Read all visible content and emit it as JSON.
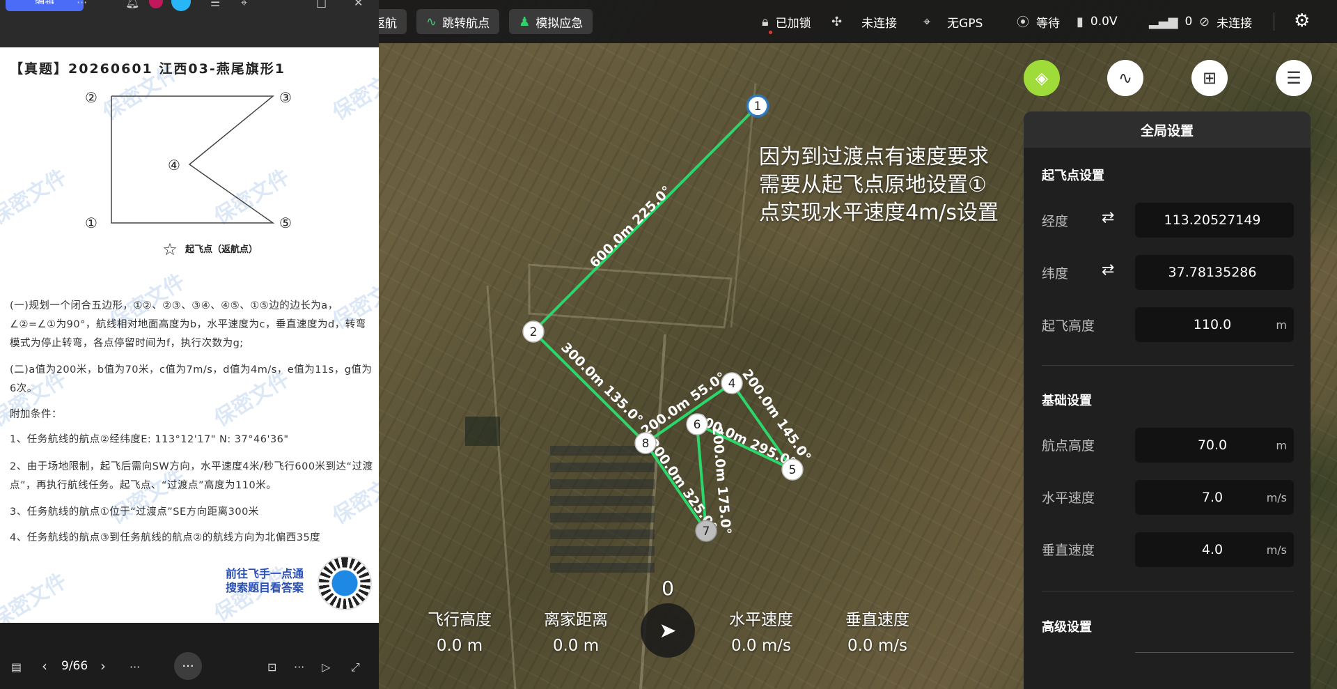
{
  "doc_viewer": {
    "edit_label": "编辑",
    "title": "【真题】20260601 江西03-燕尾旗形1",
    "diagram_labels": {
      "p1": "①",
      "p2": "②",
      "p3": "③",
      "p4": "④",
      "p5": "⑤",
      "takeoff": "起飞点（返航点）"
    },
    "paragraphs": [
      "(一)规划一个闭合五边形，①②、②③、③④、④⑤、①⑤边的边长为a，∠②=∠①为90°，航线相对地面高度为b，水平速度为c，垂直速度为d，转弯模式为停止转弯，各点停留时间为f，执行次数为g;",
      "(二)a值为200米，b值为70米，c值为7m/s，d值为4m/s，e值为11s，g值为6次。",
      "附加条件：",
      "1、任务航线的航点②经纬度E: 113°12'17\" N: 37°46'36\"",
      "2、由于场地限制，起飞后需向SW方向，水平速度4米/秒飞行600米到达“过渡点”，再执行航线任务。起飞点、“过渡点”高度为110米。",
      "3、任务航线的航点①位于“过渡点”SE方向距离300米",
      "4、任务航线的航点③到任务航线的航点②的航线方向为北偏西35度"
    ],
    "watermark": "保密文件",
    "qr_text": [
      "前往飞手一点通",
      "搜索题目看答案"
    ],
    "page_indicator": "9/66"
  },
  "toolbar": {
    "btn_return": "一键返航",
    "btn_jump": "跳转航点",
    "btn_emergency": "模拟应急",
    "lock_status": "已加锁",
    "drone_status": "未连接",
    "gps_status": "无GPS",
    "signal_status": "等待",
    "voltage": "0.0V",
    "signal_count": "0",
    "link_status": "未连接"
  },
  "map": {
    "annotation": [
      "因为到过渡点有速度要求",
      "需要从起飞点原地设置①",
      "点实现水平速度4m/s设置"
    ],
    "waypoints": [
      "1",
      "2",
      "4",
      "5",
      "6",
      "7",
      "8"
    ],
    "segment_labels": {
      "s12": "600.0m 225.0°",
      "s28": "300.0m 135.0°",
      "s84": "200.0m 55.0°",
      "s45": "200.0m 145.0°",
      "s65": "200.0m 295.0°",
      "s67": "200.0m 175.0°",
      "s87": "200.0m 325.0°"
    }
  },
  "panel": {
    "title": "全局设置",
    "takeoff_section": "起飞点设置",
    "lon_label": "经度",
    "lon_value": "113.20527149",
    "lat_label": "纬度",
    "lat_value": "37.78135286",
    "takeoff_alt_label": "起飞高度",
    "takeoff_alt_value": "110.0",
    "basic_section": "基础设置",
    "wp_alt_label": "航点高度",
    "wp_alt_value": "70.0",
    "h_speed_label": "水平速度",
    "h_speed_value": "7.0",
    "v_speed_label": "垂直速度",
    "v_speed_value": "4.0",
    "advanced_section": "高级设置",
    "unit_m": "m",
    "unit_ms": "m/s"
  },
  "telemetry": {
    "heading": "0",
    "flight_alt_label": "飞行高度",
    "flight_alt_value": "0.0 m",
    "home_dist_label": "离家距离",
    "home_dist_value": "0.0 m",
    "h_speed_label": "水平速度",
    "h_speed_value": "0.0 m/s",
    "v_speed_label": "垂直速度",
    "v_speed_value": "0.0 m/s"
  },
  "colors": {
    "route": "#2bd66b",
    "accent": "#9fdc3a",
    "primary": "#4a6cf7"
  }
}
